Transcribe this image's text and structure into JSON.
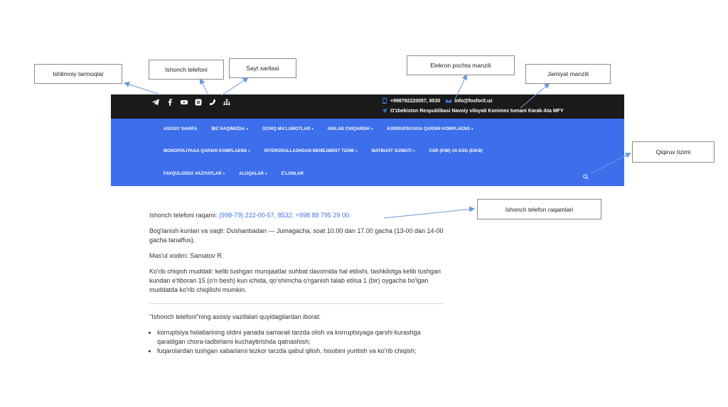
{
  "callouts": {
    "social": "Ishtimoiy tarmoqlar",
    "hotline": "Ishonch telefoni",
    "sitemap": "Sayt xaritasi",
    "email": "Elekron pochta manzili",
    "address": "Jamiyat manzili",
    "search": "Qiqiruv tizimi",
    "numbers": "Ishonch telefon raqamlari"
  },
  "topbar": {
    "phone": "+998792220057, 8530",
    "email": "info@fosforit.uz",
    "address": "O'zbekiston Respublikasi Navoiy viloyati Konimex tumani Karak-Ata MFY",
    "icons": [
      "telegram-icon",
      "facebook-icon",
      "youtube-icon",
      "instagram-icon",
      "phone-icon",
      "sitemap-icon"
    ]
  },
  "nav": {
    "row1": [
      {
        "label": "ASOSIY SAHIFA",
        "dropdown": ""
      },
      {
        "label": "BIZ HAQIMIZDA",
        "dropdown": "▾"
      },
      {
        "label": "OCHIQ MA'LUMOTLAR",
        "dropdown": "▾"
      },
      {
        "label": "ISHLAB CHIQARISH",
        "dropdown": "▾"
      },
      {
        "label": "KORRUPSIYAGA QARSHI KOMPLAENS",
        "dropdown": "▾"
      }
    ],
    "row2": [
      {
        "label": "MONOPOLIYAGA QARSHI KOMPLAENS",
        "dropdown": "▾"
      },
      {
        "label": "INTERGRALLASHGAN MENEJMENT TIZIMI",
        "dropdown": "▾"
      },
      {
        "label": "MATBUOT XIZMATI",
        "dropdown": "▾"
      },
      {
        "label": "CSR (KIM) VA ESG (EIKB)",
        "dropdown": ""
      }
    ],
    "row3": [
      {
        "label": "FAVQULODDA VAZIYATLAR",
        "dropdown": "▾"
      },
      {
        "label": "ALOQALAR",
        "dropdown": "▾"
      },
      {
        "label": "E'LONLAR",
        "dropdown": ""
      }
    ]
  },
  "content": {
    "hotline_label": "Ishonch telefoni raqami: ",
    "hotline_numbers": "(998-79) 222-00-57, 8532; +998 88 795 29 00.",
    "hours": "Bog'lanish kunlari va vaqti: Dushanbadan — Jumagacha, soat 10.00 dan 17.00 gacha (13-00 dan 14-00 gacha tanaffus).",
    "officer": "Mas'ul xodim: Samatov R.",
    "period": "Ko'rib chiqish muddati: kelib tushgan murojaatlar suhbat davomida hal etilishi, tashkilotga kelib tushgan kundan e'tiboran 15 (o'n besh) kun ichida, qo'shimcha o'rganish talab etilsa 1 (bir) oygacha bo'lgan muddatda ko'rib chiqilishi mumkin.",
    "tasks_intro": "\"Ishonch telefoni\"ning asosiy vazifalari quyidagilardan iborat:",
    "tasks": [
      "korruptsiya holatlarining oldini yanada samarali tarzda olish va korruptsiyaga qarshi kurashga qaratilgan chora-tadbirlarni kuchaytirishda qatnashish;",
      "fuqarolardan tushgan xabarlarni tezkor tarzda qabul qilish, hisobini yuritish va ko'rib chiqish;"
    ]
  }
}
